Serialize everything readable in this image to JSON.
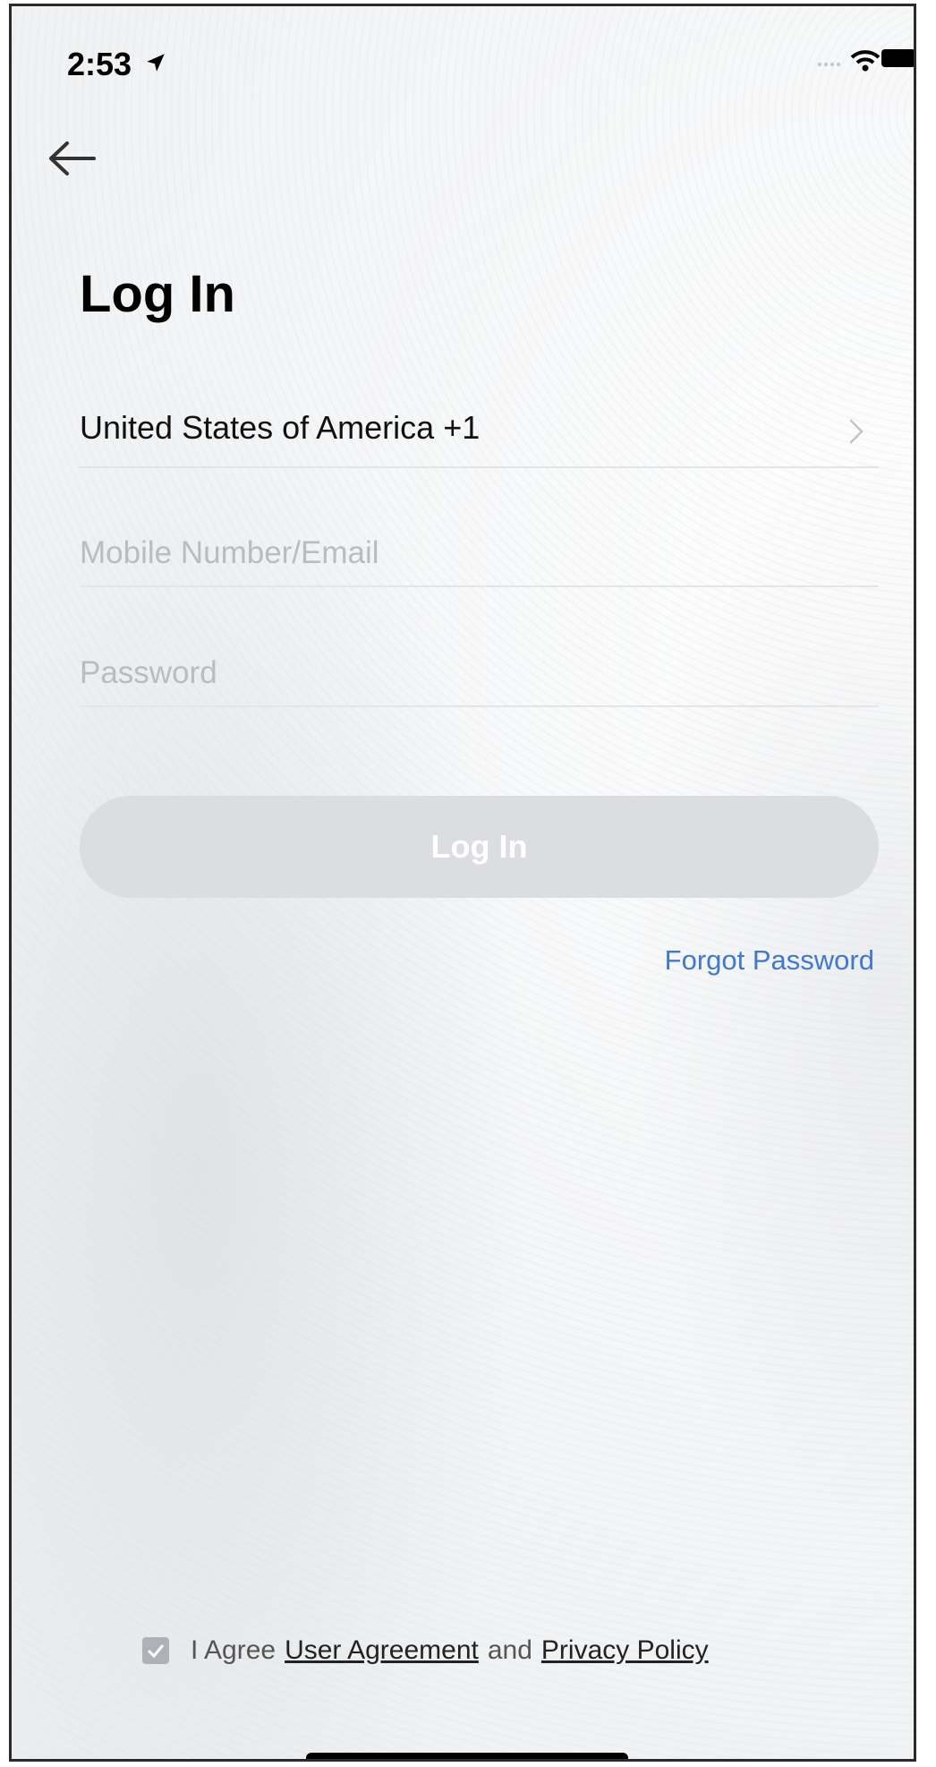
{
  "status_bar": {
    "time": "2:53"
  },
  "header": {
    "title": "Log In"
  },
  "form": {
    "country": "United States of America +1",
    "email_placeholder": "Mobile Number/Email",
    "password_placeholder": "Password",
    "login_button": "Log In",
    "forgot_password": "Forgot Password"
  },
  "agreement": {
    "prefix": "I Agree",
    "user_agreement": "User Agreement",
    "connector": "and",
    "privacy_policy": "Privacy Policy",
    "checked": true
  },
  "colors": {
    "accent_link": "#3f79cf",
    "button_disabled": "#dcdde0"
  }
}
